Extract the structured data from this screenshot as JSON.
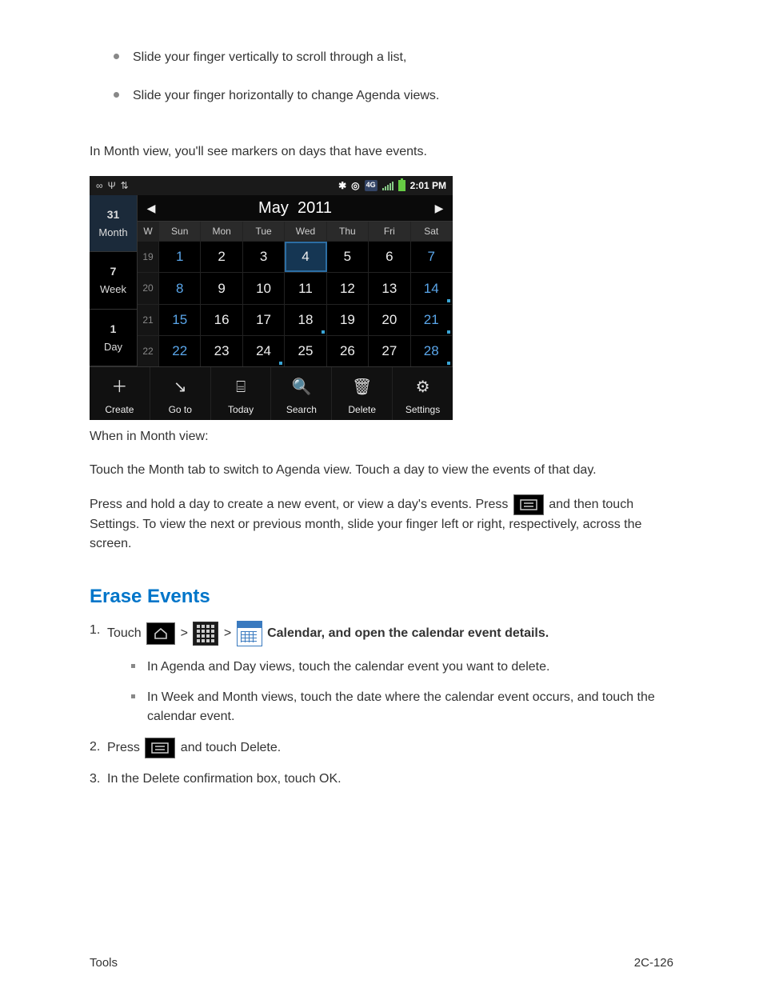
{
  "bullets_top": [
    "Slide your finger vertically to scroll through a list,",
    "Slide your finger horizontally to change Agenda views."
  ],
  "intro_para": "In Month view, you'll see markers on days that have events.",
  "phone": {
    "statusbar": {
      "time": "2:01 PM",
      "net": "4G"
    },
    "view_tabs": [
      {
        "icon": "31",
        "label": "Month",
        "selected": true
      },
      {
        "icon": "7",
        "label": "Week",
        "selected": false
      },
      {
        "icon": "1",
        "label": "Day",
        "selected": false
      }
    ],
    "header": {
      "prev": "◀",
      "month": "May",
      "year": "2011",
      "next": "▶"
    },
    "day_headers": [
      "W",
      "Sun",
      "Mon",
      "Tue",
      "Wed",
      "Thu",
      "Fri",
      "Sat"
    ],
    "weeks": [
      {
        "w": "19",
        "days": [
          "1",
          "2",
          "3",
          "4",
          "5",
          "6",
          "7"
        ],
        "today_idx": 3,
        "events": []
      },
      {
        "w": "20",
        "days": [
          "8",
          "9",
          "10",
          "11",
          "12",
          "13",
          "14"
        ],
        "today_idx": -1,
        "events": [
          6
        ]
      },
      {
        "w": "21",
        "days": [
          "15",
          "16",
          "17",
          "18",
          "19",
          "20",
          "21"
        ],
        "today_idx": -1,
        "events": [
          3,
          6
        ]
      },
      {
        "w": "22",
        "days": [
          "22",
          "23",
          "24",
          "25",
          "26",
          "27",
          "28"
        ],
        "today_idx": -1,
        "events": [
          2,
          6
        ]
      }
    ],
    "bottom": [
      {
        "icon": "＋",
        "label": "Create"
      },
      {
        "icon": "↘",
        "label": "Go to"
      },
      {
        "icon": "⌸",
        "label": "Today"
      },
      {
        "icon": "🔍",
        "label": "Search"
      },
      {
        "icon": "🗑",
        "label": "Delete"
      },
      {
        "icon": "⚙",
        "label": "Settings"
      }
    ]
  },
  "after_phone": {
    "p1_pre": "When in Month view:",
    "p2": "Touch the Month tab to switch to Agenda view. Touch a day to view the events of that day.",
    "p3_pre": "Press and hold a day to create a new event, or view a day's events. Press ",
    "p3_post": " and then touch Settings. To view the next or previous month, slide your finger left or right, respectively, across the screen."
  },
  "heading": "Erase Events",
  "erase": {
    "step1_pre": "Touch ",
    "step1_mid1": " > ",
    "step1_mid2": " > ",
    "step1_post": " Calendar, and open the calendar event details.",
    "sub1": "In Agenda and Day views, touch the calendar event you want to delete.",
    "sub2": "In Week and Month views, touch the date where the calendar event occurs, and touch the calendar event.",
    "step2_pre": "Press ",
    "step2_post": "  and touch Delete.",
    "step3": "In the Delete confirmation box, touch OK."
  },
  "footer": {
    "left": "Tools",
    "right": "2C-126"
  }
}
